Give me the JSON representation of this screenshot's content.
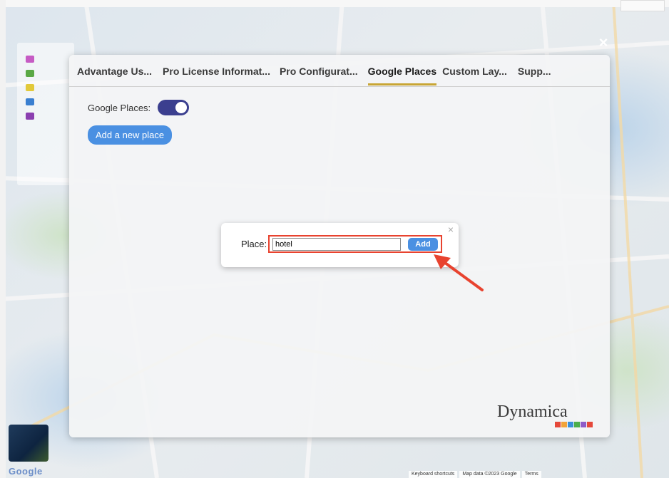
{
  "overlay": {
    "close_glyph": "×"
  },
  "tabs": [
    {
      "label": "Advantage Us...",
      "active": false
    },
    {
      "label": "Pro License Informat...",
      "active": false
    },
    {
      "label": "Pro Configurat...",
      "active": false
    },
    {
      "label": "Google Places",
      "active": true
    },
    {
      "label": "Custom Lay...",
      "active": false
    },
    {
      "label": "Supp...",
      "active": false
    }
  ],
  "google_places": {
    "toggle_label": "Google Places:",
    "enabled": true,
    "add_button": "Add a new place"
  },
  "dialog": {
    "close_glyph": "×",
    "label": "Place:",
    "input_value": "hotel",
    "add_button": "Add"
  },
  "brand": {
    "name": "Dynamica"
  },
  "map": {
    "logo": "Google",
    "attribution": [
      "Keyboard shortcuts",
      "Map data ©2023 Google",
      "Terms"
    ]
  },
  "colors": {
    "accent": "#4a90e2",
    "toggle_on": "#3b3f8f",
    "active_tab_underline": "#c8a534",
    "highlight": "#e8432f"
  }
}
